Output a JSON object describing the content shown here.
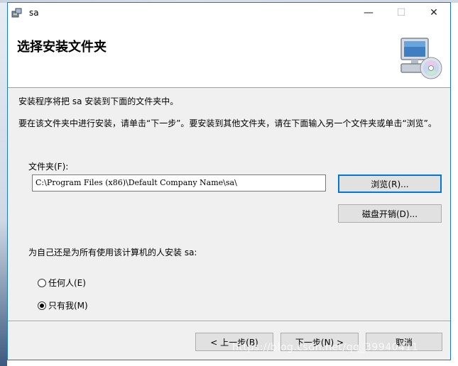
{
  "window": {
    "title": "sa"
  },
  "titlebar_buttons": {
    "minimize": "—",
    "maximize": "☐",
    "close": "✕"
  },
  "header": {
    "title": "选择安装文件夹"
  },
  "content": {
    "intro": "安装程序将把 sa 安装到下面的文件夹中。",
    "instructions": "要在该文件夹中进行安装，请单击“下一步”。要安装到其他文件夹，请在下面输入另一个文件夹或单击“浏览”。",
    "folder_label": "文件夹(F):",
    "folder_value": "C:\\Program Files (x86)\\Default Company Name\\sa\\",
    "browse_label": "浏览(R)...",
    "disk_cost_label": "磁盘开销(D)...",
    "install_for_label": "为自己还是为所有使用该计算机的人安装 sa:",
    "options": [
      {
        "label": "任何人(E)",
        "selected": false
      },
      {
        "label": "只有我(M)",
        "selected": true
      }
    ]
  },
  "footer": {
    "prev_label": "< 上一步(B)",
    "next_label": "下一步(N) >",
    "cancel_label": "取消"
  },
  "watermark": "https://blog.csdn.net/qq_39940411",
  "colors": {
    "window_border": "#1979ca",
    "default_button_border": "#0078d7",
    "dialog_bg": "#f0f0f0"
  },
  "icons": {
    "app": "installer-box-icon",
    "header": "computer-cd-icon"
  }
}
